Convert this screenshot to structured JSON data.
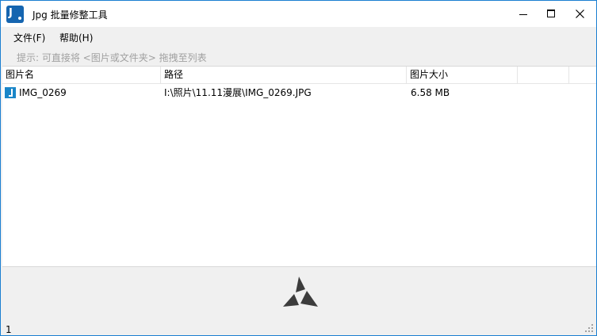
{
  "window": {
    "title": "Jpg 批量修整工具",
    "icon": "app-icon",
    "accent": "#1b7fd1"
  },
  "menu": {
    "file": "文件(F)",
    "help": "帮助(H)"
  },
  "hint": "提示: 可直接将 <图片或文件夹> 拖拽至列表",
  "table": {
    "columns": [
      "图片名",
      "路径",
      "图片大小",
      ""
    ],
    "rows": [
      {
        "name": "IMG_0269",
        "path": "I:\\照片\\11.11漫展\\IMG_0269.JPG",
        "size": "6.58 MB",
        "icon": "image-file-icon"
      }
    ]
  },
  "status": {
    "count": "1"
  }
}
